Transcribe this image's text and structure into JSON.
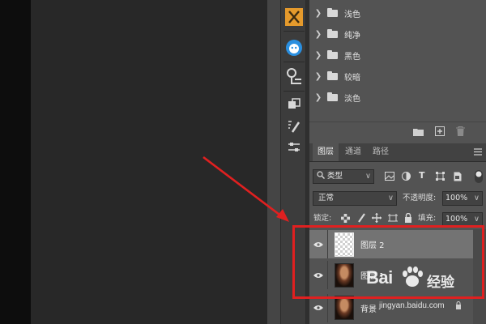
{
  "swatch_groups": {
    "folders": [
      {
        "label": "浅色"
      },
      {
        "label": "纯净"
      },
      {
        "label": "黑色"
      },
      {
        "label": "较暗"
      },
      {
        "label": "淡色"
      }
    ]
  },
  "layers_panel": {
    "tabs": [
      {
        "label": "图层",
        "active": true
      },
      {
        "label": "通道",
        "active": false
      },
      {
        "label": "路径",
        "active": false
      }
    ],
    "filter_kind": "类型",
    "blend_mode": "正常",
    "opacity_label": "不透明度:",
    "opacity_value": "100%",
    "lock_label": "锁定:",
    "fill_label": "填充:",
    "fill_value": "100%",
    "layers": [
      {
        "name": "图层 2",
        "thumbnail": "transparent",
        "selected": true,
        "visible": true
      },
      {
        "name": "图层 1",
        "thumbnail": "portrait",
        "selected": false,
        "visible": true
      },
      {
        "name": "背景",
        "thumbnail": "portrait",
        "selected": false,
        "visible": true,
        "locked": true
      }
    ]
  },
  "watermark": {
    "brand_text": "Bai",
    "brand_suffix": "经验",
    "url": "jingyan.baidu.com"
  },
  "annotation": {
    "color": "#e02020"
  },
  "colors": {
    "accent_red": "#e02020",
    "panel_bg": "#535353",
    "selected_row": "#737373"
  }
}
